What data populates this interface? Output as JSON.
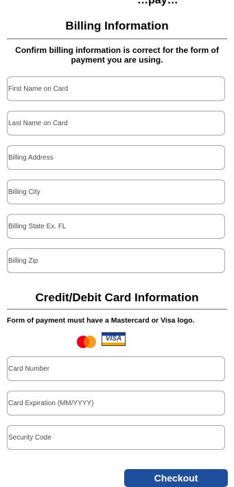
{
  "billing": {
    "title": "Billing Information",
    "subtitle": "Confirm billing information is correct for the form of payment you are using.",
    "fields": {
      "first_name": "First Name on Card",
      "last_name": "Last Name on Card",
      "address": "Billing Address",
      "city": "Billing City",
      "state": "Billing State Ex. FL",
      "zip": "Billing Zip"
    }
  },
  "card": {
    "title": "Credit/Debit Card Information",
    "note": "Form of payment must have a Mastercard or Visa logo.",
    "logos": {
      "mastercard_icon": "mastercard-logo",
      "visa_text": "VISA"
    },
    "fields": {
      "number": "Card Number",
      "expiration": "Card Expiration (MM/YYYY)",
      "security": "Security Code"
    }
  },
  "actions": {
    "checkout_label": "Checkout"
  },
  "colors": {
    "button": "#1e4f9c",
    "visa_blue": "#1a3d8f",
    "visa_gold": "#f2a900",
    "mc_red": "#eb001b",
    "mc_orange": "#f79e1b"
  }
}
